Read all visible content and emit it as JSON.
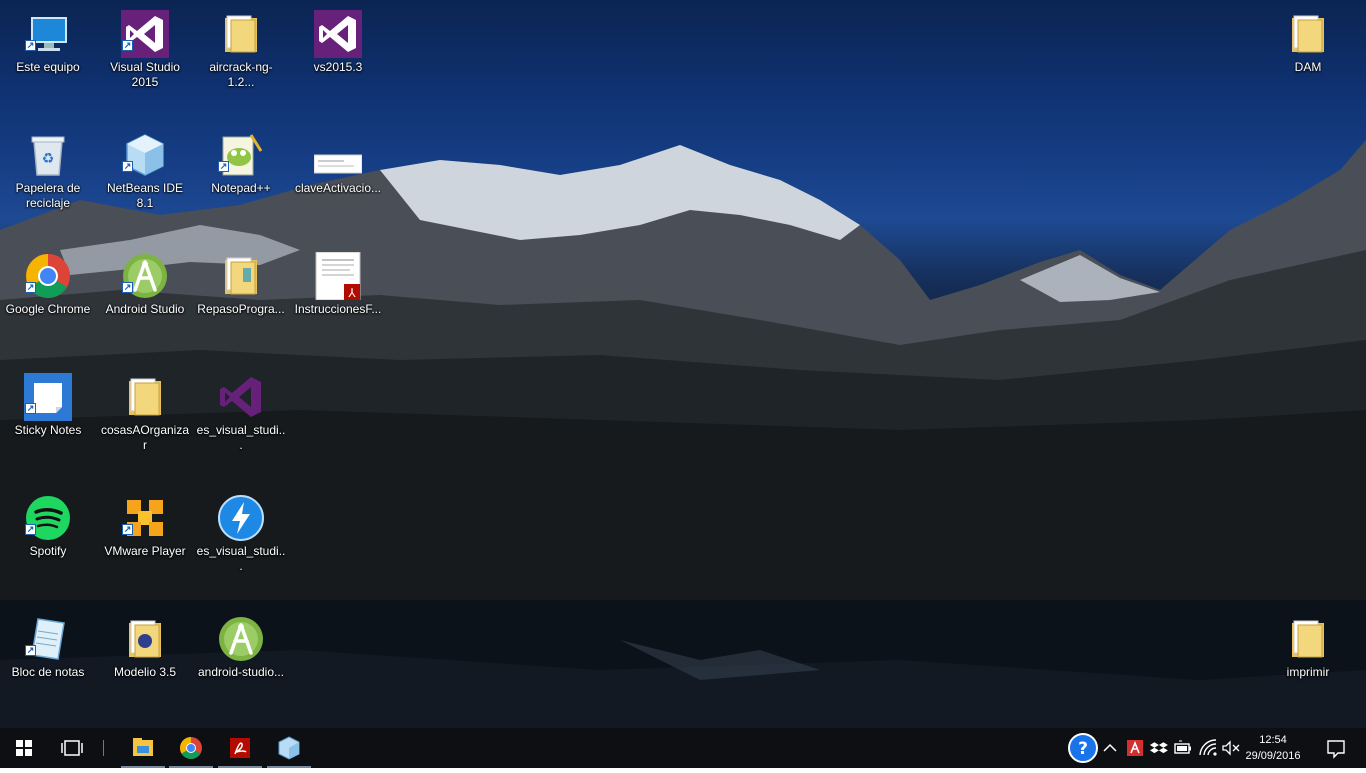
{
  "desktop": {
    "icons_left": [
      {
        "label": "Este equipo",
        "icon": "computer-icon",
        "shortcut": true
      },
      {
        "label": "Visual Studio 2015",
        "icon": "visual-studio-icon",
        "shortcut": true
      },
      {
        "label": "aircrack-ng-1.2...",
        "icon": "folder-icon",
        "shortcut": false
      },
      {
        "label": "vs2015.3",
        "icon": "visual-studio-icon",
        "shortcut": false
      },
      {
        "label": "Papelera de reciclaje",
        "icon": "recycle-bin-icon",
        "shortcut": false
      },
      {
        "label": "NetBeans IDE 8.1",
        "icon": "netbeans-icon",
        "shortcut": true
      },
      {
        "label": "Notepad++",
        "icon": "notepadpp-icon",
        "shortcut": true
      },
      {
        "label": "claveActivacio...",
        "icon": "image-file-icon",
        "shortcut": false
      },
      {
        "label": "Google Chrome",
        "icon": "chrome-icon",
        "shortcut": true
      },
      {
        "label": "Android Studio",
        "icon": "android-studio-icon",
        "shortcut": true
      },
      {
        "label": "RepasoProgra...",
        "icon": "folder-icon",
        "shortcut": false
      },
      {
        "label": "InstruccionesF...",
        "icon": "pdf-file-icon",
        "shortcut": false
      },
      {
        "label": "Sticky Notes",
        "icon": "sticky-notes-icon",
        "shortcut": true
      },
      {
        "label": "cosasAOrganizar",
        "icon": "folder-icon",
        "shortcut": false
      },
      {
        "label": "es_visual_studi...",
        "icon": "visual-studio-icon",
        "shortcut": false
      },
      {
        "label": "Spotify",
        "icon": "spotify-icon",
        "shortcut": true
      },
      {
        "label": "VMware Player",
        "icon": "vmware-icon",
        "shortcut": true
      },
      {
        "label": "es_visual_studi...",
        "icon": "installer-icon",
        "shortcut": false
      },
      {
        "label": "Bloc de notas",
        "icon": "notepad-icon",
        "shortcut": true
      },
      {
        "label": "Modelio 3.5",
        "icon": "folder-icon",
        "shortcut": false
      },
      {
        "label": "android-studio...",
        "icon": "android-studio-icon",
        "shortcut": false
      }
    ],
    "icons_right": [
      {
        "label": "DAM",
        "icon": "folder-icon",
        "shortcut": false
      },
      {
        "label": "imprimir",
        "icon": "folder-icon",
        "shortcut": false
      }
    ]
  },
  "taskbar": {
    "start_icon": "windows-logo-icon",
    "task_view_icon": "task-view-icon",
    "pinned": [
      "file-explorer-icon",
      "chrome-icon",
      "acrobat-icon",
      "netbeans-icon"
    ],
    "tray": [
      "help-icon",
      "chevron-up-icon",
      "avira-icon",
      "dropbox-icon",
      "battery-icon",
      "wifi-icon",
      "volume-muted-icon"
    ],
    "time": "12:54",
    "date": "29/09/2016",
    "notifications_icon": "action-center-icon"
  },
  "colors": {
    "taskbar": "#0d0f12",
    "vs_purple": "#68217a",
    "folder": "#e8c25a"
  }
}
